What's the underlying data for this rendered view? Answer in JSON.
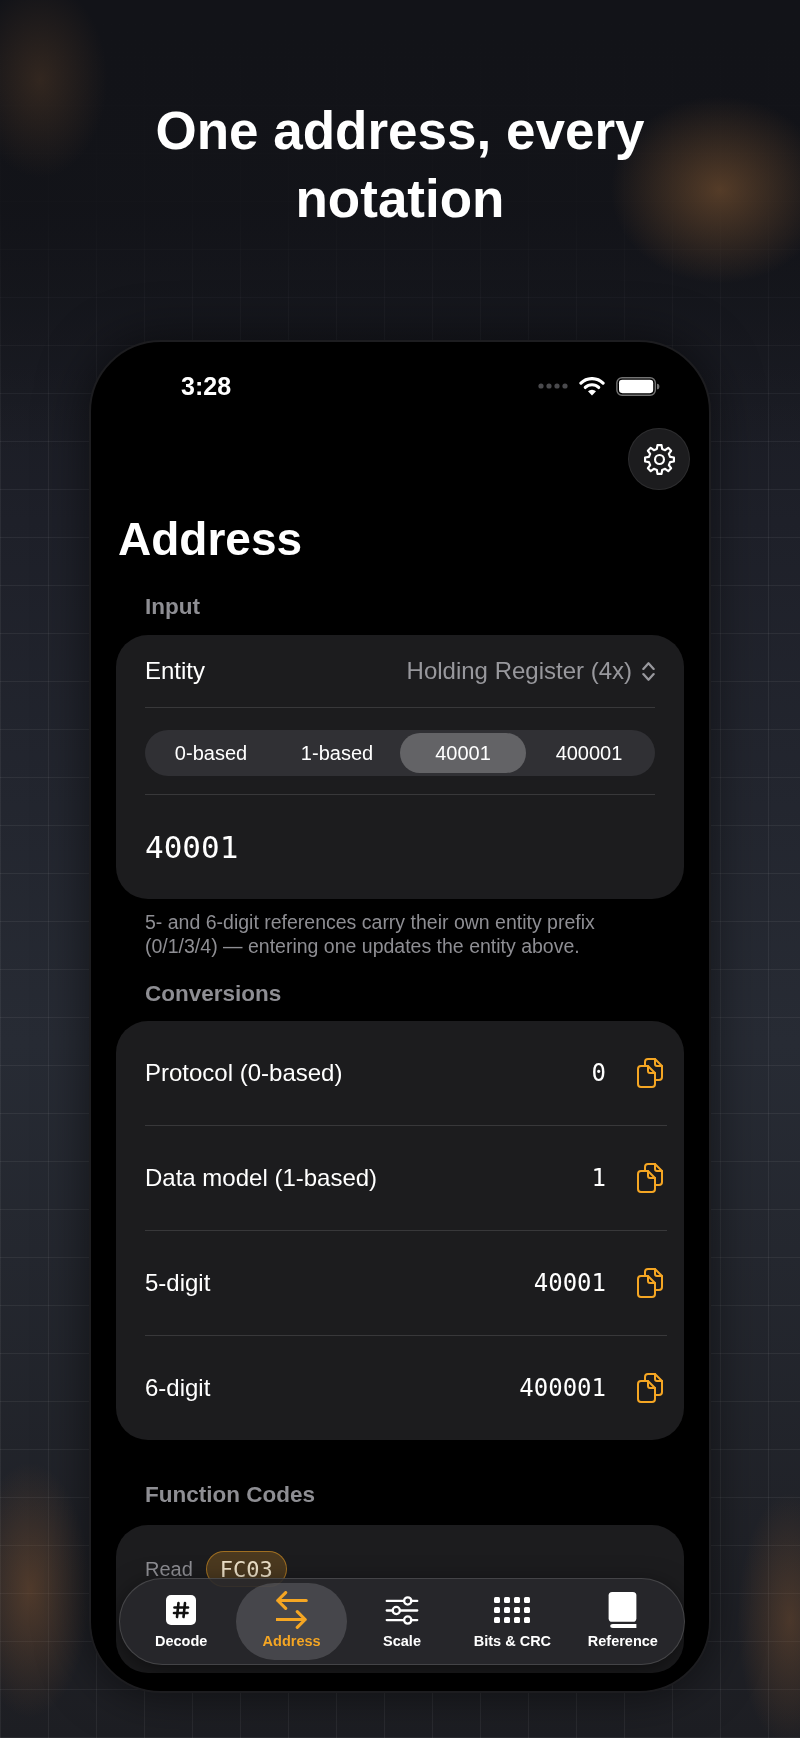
{
  "headline": "One address, every notation",
  "status_bar": {
    "time": "3:28"
  },
  "title": "Address",
  "input": {
    "header": "Input",
    "entity_label": "Entity",
    "entity_value": "Holding Register (4x)",
    "notations": [
      {
        "label": "0-based",
        "selected": false
      },
      {
        "label": "1-based",
        "selected": false
      },
      {
        "label": "40001",
        "selected": true
      },
      {
        "label": "400001",
        "selected": false
      }
    ],
    "value": "40001",
    "footnote": "5- and 6-digit references carry their own entity prefix (0/1/3/4) — entering one updates the entity above."
  },
  "conversions": {
    "header": "Conversions",
    "rows": [
      {
        "label": "Protocol (0-based)",
        "value": "0"
      },
      {
        "label": "Data model (1-based)",
        "value": "1"
      },
      {
        "label": "5-digit",
        "value": "40001"
      },
      {
        "label": "6-digit",
        "value": "400001"
      }
    ]
  },
  "function_codes": {
    "header": "Function Codes",
    "rows": [
      {
        "label": "Read",
        "codes": [
          "FC03"
        ]
      }
    ]
  },
  "tabs": [
    {
      "label": "Decode",
      "selected": false
    },
    {
      "label": "Address",
      "selected": true
    },
    {
      "label": "Scale",
      "selected": false
    },
    {
      "label": "Bits & CRC",
      "selected": false
    },
    {
      "label": "Reference",
      "selected": false
    }
  ]
}
